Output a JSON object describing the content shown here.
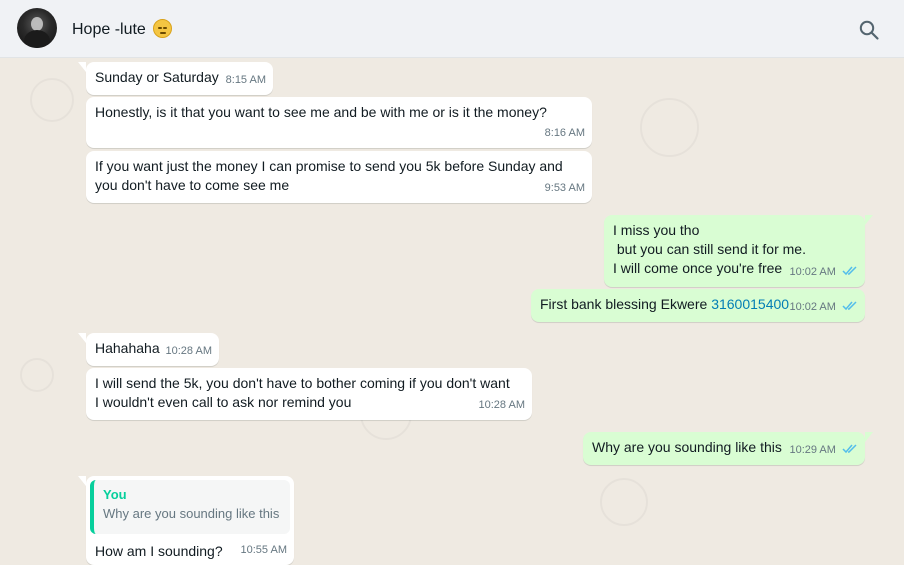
{
  "header": {
    "contact_name": "Hope -lute",
    "contact_emoji_icon": "pensive-face-emoji"
  },
  "colors": {
    "incoming_bubble": "#ffffff",
    "outgoing_bubble": "#d9fdd3",
    "read_ticks": "#53bdeb",
    "link": "#027eb5",
    "quote_accent": "#06cf9c"
  },
  "messages": [
    {
      "direction": "incoming",
      "text": "Sunday or Saturday",
      "time": "8:15 AM"
    },
    {
      "direction": "incoming",
      "text": "Honestly, is it that you want to see me and be with me or is it the money?",
      "time": "8:16 AM"
    },
    {
      "direction": "incoming",
      "lines": [
        "If you want just the money I can promise to send you 5k before Sunday and",
        "you don't have to come see me"
      ],
      "time": "9:53 AM"
    },
    {
      "direction": "outgoing",
      "lines": [
        "I miss you tho",
        " but you can still send it for me.",
        "I will come once you're free"
      ],
      "time": "10:02 AM",
      "status": "read"
    },
    {
      "direction": "outgoing",
      "text": "First bank blessing Ekwere",
      "link": "3160015400",
      "time": "10:02 AM",
      "status": "read"
    },
    {
      "direction": "incoming",
      "text": "Hahahaha",
      "time": "10:28 AM"
    },
    {
      "direction": "incoming",
      "lines": [
        "I will send the 5k, you don't have to bother coming if you don't want",
        "I wouldn't even call to ask nor remind you"
      ],
      "time": "10:28 AM"
    },
    {
      "direction": "outgoing",
      "text": "Why are you sounding like this",
      "time": "10:29 AM",
      "status": "read"
    },
    {
      "direction": "incoming",
      "quote": {
        "author": "You",
        "text": "Why are you sounding like this"
      },
      "text": "How am I sounding?",
      "time": "10:55 AM"
    }
  ]
}
